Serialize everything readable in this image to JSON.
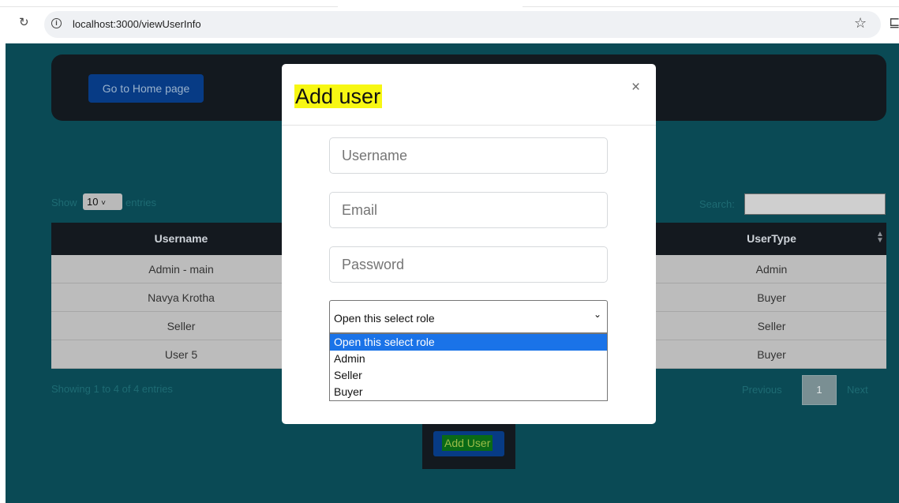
{
  "browser": {
    "url": "localhost:3000/viewUserInfo"
  },
  "navbar": {
    "home_button": "Go to Home page"
  },
  "table_controls": {
    "show_label": "Show",
    "entries_value": "10",
    "entries_label": "entries",
    "search_label": "Search:"
  },
  "table": {
    "columns": [
      "Username",
      "UserType"
    ],
    "rows": [
      {
        "username": "Admin - main",
        "usertype": "Admin"
      },
      {
        "username": "Navya Krotha",
        "usertype": "Buyer"
      },
      {
        "username": "Seller",
        "usertype": "Seller"
      },
      {
        "username": "User 5",
        "usertype": "Buyer"
      }
    ]
  },
  "footer": {
    "showing": "Showing 1 to 4 of 4 entries",
    "previous": "Previous",
    "page": "1",
    "next": "Next"
  },
  "add_user_button": "Add User",
  "modal": {
    "title": "Add user",
    "close": "×",
    "username_placeholder": "Username",
    "email_placeholder": "Email",
    "password_placeholder": "Password",
    "role_selected": "Open this select role",
    "role_options": [
      "Open this select role",
      "Admin",
      "Seller",
      "Buyer"
    ]
  }
}
